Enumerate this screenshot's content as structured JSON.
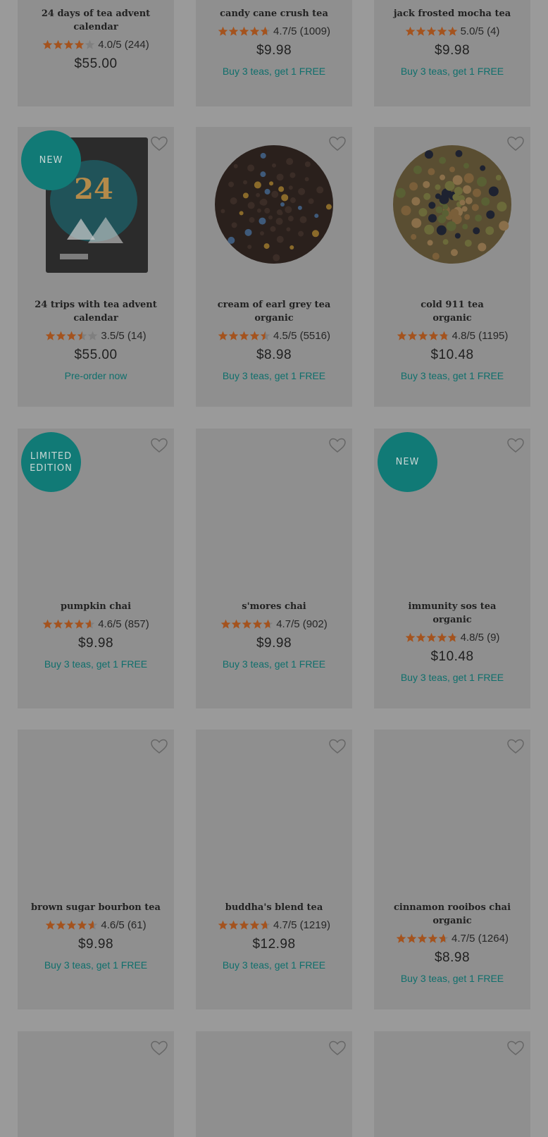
{
  "colors": {
    "page_overlay": "#9a9a9a",
    "card": "#8f8f8f",
    "accent_teal": "#117a76",
    "star": "#a4531e",
    "text": "#222222"
  },
  "icons": {
    "wishlist": "heart-outline-icon",
    "rating": "star-icon"
  },
  "products": [
    {
      "name": "24 days of tea advent calendar",
      "rating_text": "4.0/5 (244)",
      "stars": 4.0,
      "price": "$55.00",
      "promo": "",
      "badge": ""
    },
    {
      "name": "candy cane crush tea",
      "rating_text": "4.7/5 (1009)",
      "stars": 4.7,
      "price": "$9.98",
      "promo": "Buy 3 teas, get 1 FREE",
      "badge": ""
    },
    {
      "name": "jack frosted mocha tea",
      "rating_text": "5.0/5 (4)",
      "stars": 5.0,
      "price": "$9.98",
      "promo": "Buy 3 teas, get 1 FREE",
      "badge": ""
    },
    {
      "name": "24 trips with tea advent calendar",
      "rating_text": "3.5/5 (14)",
      "stars": 3.5,
      "price": "$55.00",
      "promo": "Pre-order now",
      "badge": "NEW",
      "image": "advent-box"
    },
    {
      "name": "cream of earl grey tea",
      "subtitle": "organic",
      "rating_text": "4.5/5 (5516)",
      "stars": 4.5,
      "price": "$8.98",
      "promo": "Buy 3 teas, get 1 FREE",
      "badge": "",
      "image": "black-leaf"
    },
    {
      "name": "cold 911 tea",
      "subtitle": "organic",
      "rating_text": "4.8/5 (1195)",
      "stars": 4.8,
      "price": "$10.48",
      "promo": "Buy 3 teas, get 1 FREE",
      "badge": "",
      "image": "herbal-leaf"
    },
    {
      "name": "pumpkin chai",
      "rating_text": "4.6/5 (857)",
      "stars": 4.6,
      "price": "$9.98",
      "promo": "Buy 3 teas, get 1 FREE",
      "badge": "LIMITED\nEDITION"
    },
    {
      "name": "s'mores chai",
      "rating_text": "4.7/5 (902)",
      "stars": 4.7,
      "price": "$9.98",
      "promo": "Buy 3 teas, get 1 FREE",
      "badge": ""
    },
    {
      "name": "immunity sos tea",
      "subtitle": "organic",
      "rating_text": "4.8/5 (9)",
      "stars": 4.8,
      "price": "$10.48",
      "promo": "Buy 3 teas, get 1 FREE",
      "badge": "NEW"
    },
    {
      "name": "brown sugar bourbon tea",
      "rating_text": "4.6/5 (61)",
      "stars": 4.6,
      "price": "$9.98",
      "promo": "Buy 3 teas, get 1 FREE",
      "badge": ""
    },
    {
      "name": "buddha's blend tea",
      "rating_text": "4.7/5 (1219)",
      "stars": 4.7,
      "price": "$12.98",
      "promo": "Buy 3 teas, get 1 FREE",
      "badge": ""
    },
    {
      "name": "cinnamon rooibos chai",
      "subtitle": "organic",
      "rating_text": "4.7/5 (1264)",
      "stars": 4.7,
      "price": "$8.98",
      "promo": "Buy 3 teas, get 1 FREE",
      "badge": ""
    },
    {
      "name": "",
      "rating_text": "",
      "price": "",
      "promo": "",
      "badge": ""
    },
    {
      "name": "",
      "rating_text": "",
      "price": "",
      "promo": "",
      "badge": ""
    },
    {
      "name": "",
      "rating_text": "",
      "price": "",
      "promo": "",
      "badge": ""
    }
  ]
}
